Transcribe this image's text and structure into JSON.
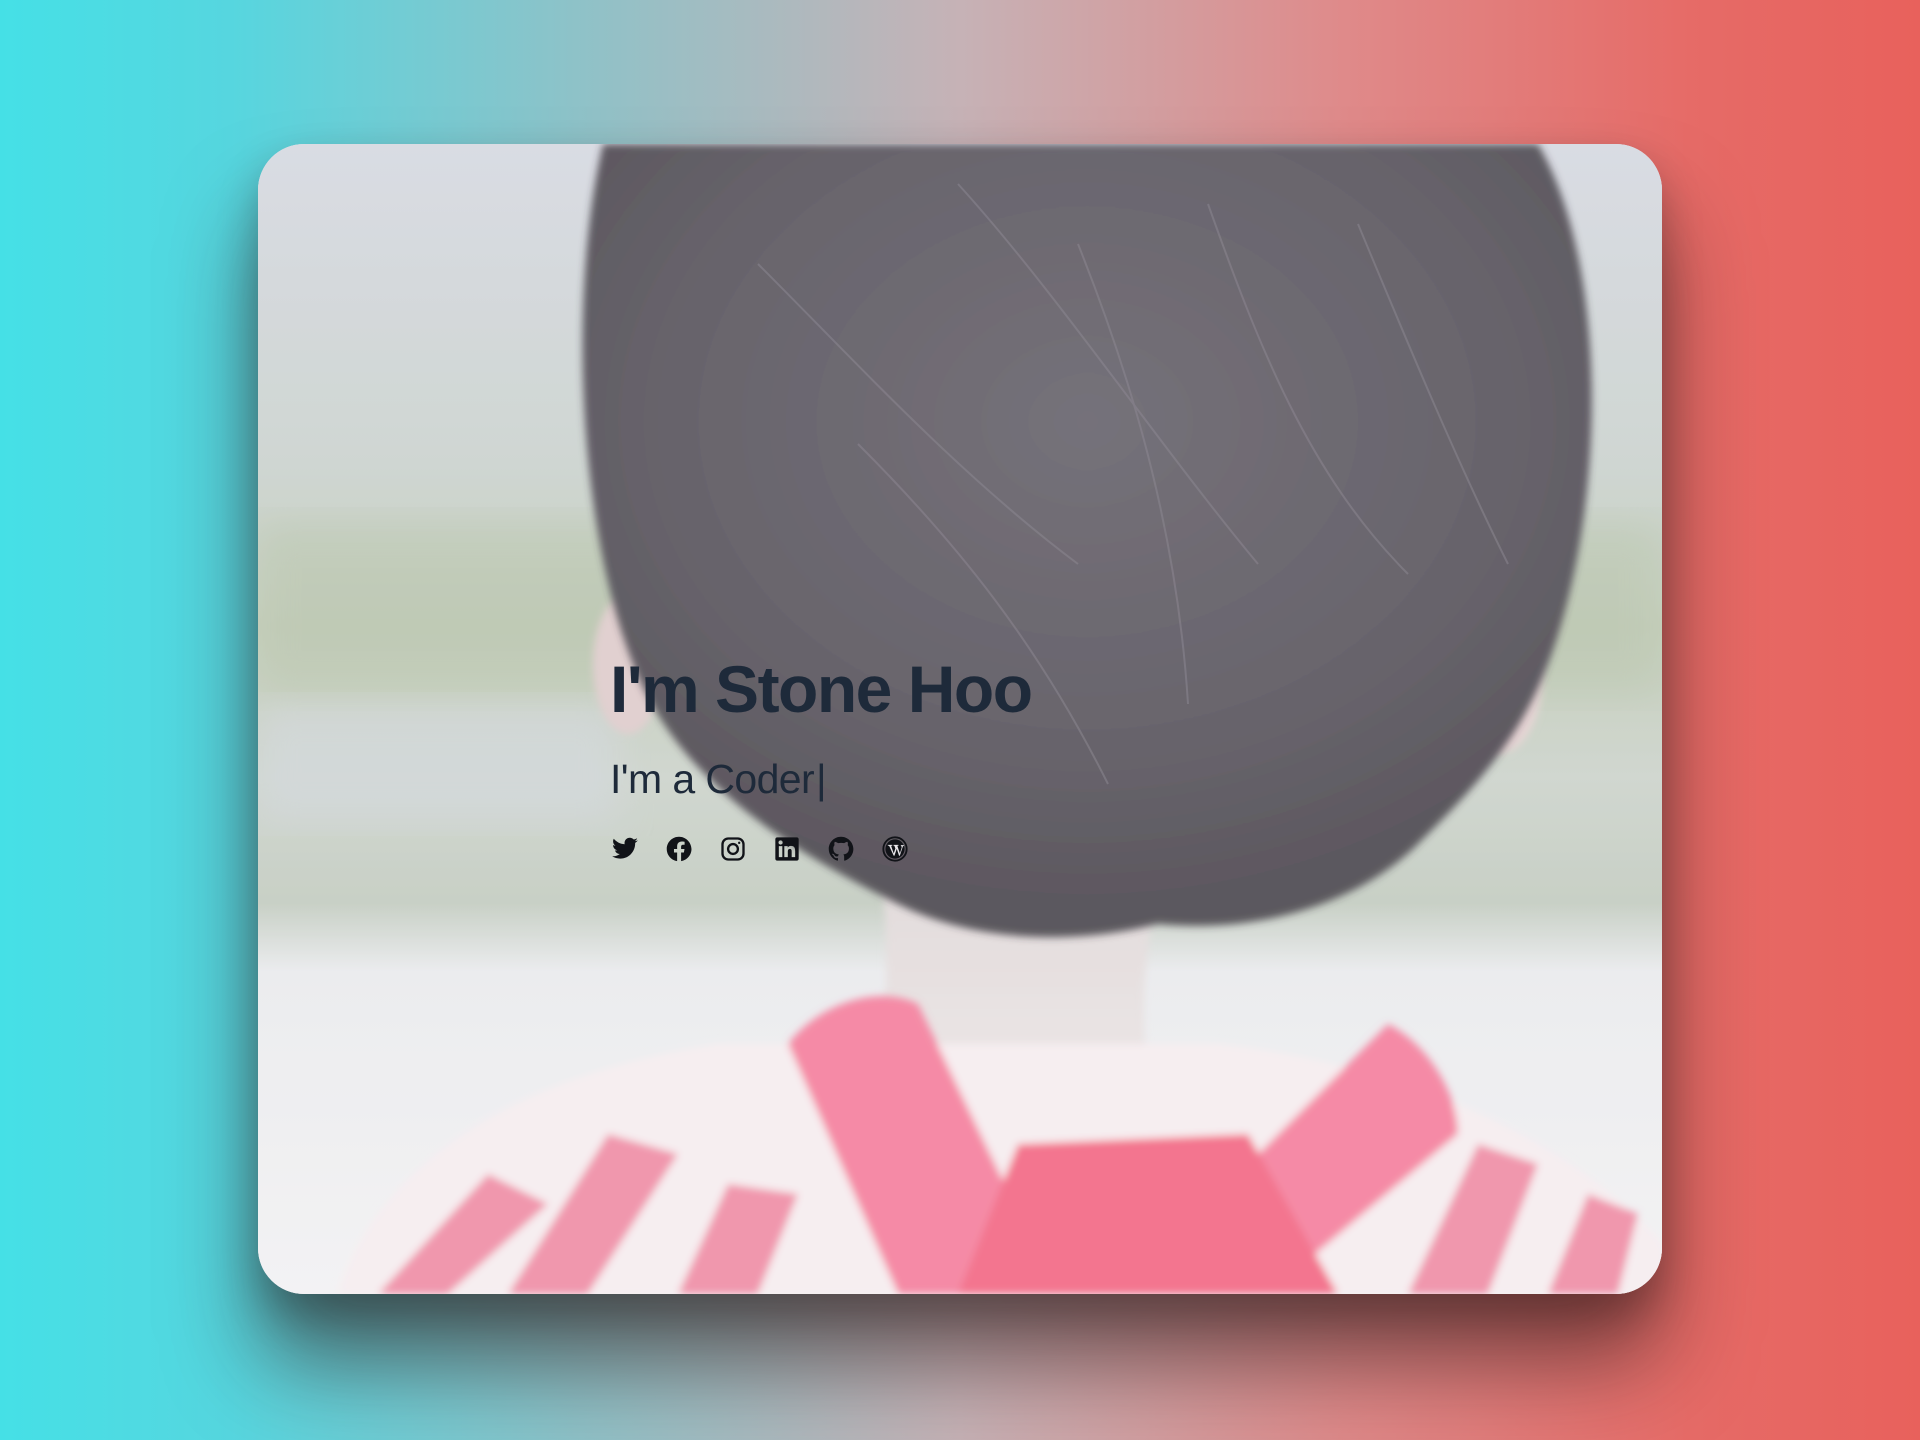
{
  "hero": {
    "name": "I'm Stone Hoo",
    "tagline_prefix": "I'm a ",
    "tagline_role": "Coder",
    "cursor": "|"
  },
  "socials": [
    {
      "icon": "twitter-icon"
    },
    {
      "icon": "facebook-icon"
    },
    {
      "icon": "instagram-icon"
    },
    {
      "icon": "linkedin-icon"
    },
    {
      "icon": "github-icon"
    },
    {
      "icon": "wordpress-icon"
    }
  ],
  "colors": {
    "background_left": "#45e0e6",
    "background_right": "#e8615c",
    "text": "#1e2a3a",
    "icon": "#111318"
  }
}
